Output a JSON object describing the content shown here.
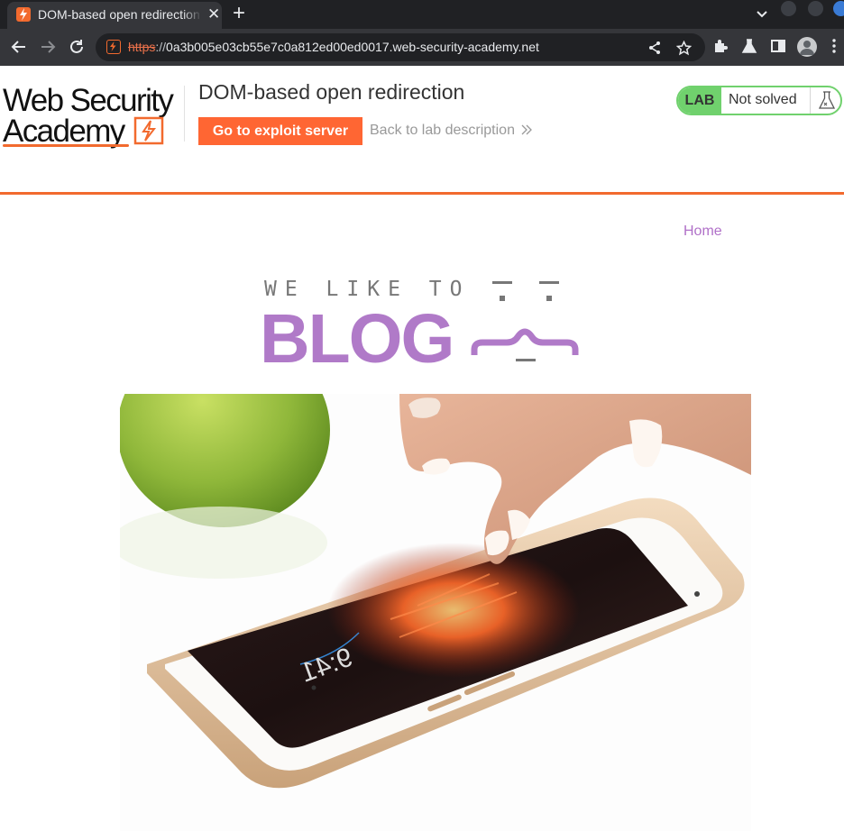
{
  "browser": {
    "tab_title": "DOM-based open redirection",
    "tab_close": "✕",
    "new_tab": "+",
    "url_scheme": "https",
    "url_sep": "://",
    "url_host": "0a3b005e03cb55e7c0a812ed00ed0017.web-security-academy.net",
    "icons": [
      "back-icon",
      "forward-icon",
      "reload-icon",
      "site-info-icon",
      "share-icon",
      "bookmark-star-icon",
      "extensions-icon",
      "labs-flask-icon",
      "side-panel-icon",
      "profile-icon",
      "menu-icon"
    ]
  },
  "lab_header": {
    "logo_line1": "Web Security",
    "logo_line2": "Academy",
    "title": "DOM-based open redirection",
    "exploit_button": "Go to exploit server",
    "back_link": "Back to lab description",
    "status_badge": "LAB",
    "status_text": "Not solved",
    "accent_color": "#f26a2e",
    "status_color": "#70d16d"
  },
  "blog": {
    "nav_home": "Home",
    "tagline": "WE LIKE TO",
    "wordmark": "BLOG",
    "brand_color": "#b07ac8",
    "hero_image": "smartphone-hand-photo"
  }
}
